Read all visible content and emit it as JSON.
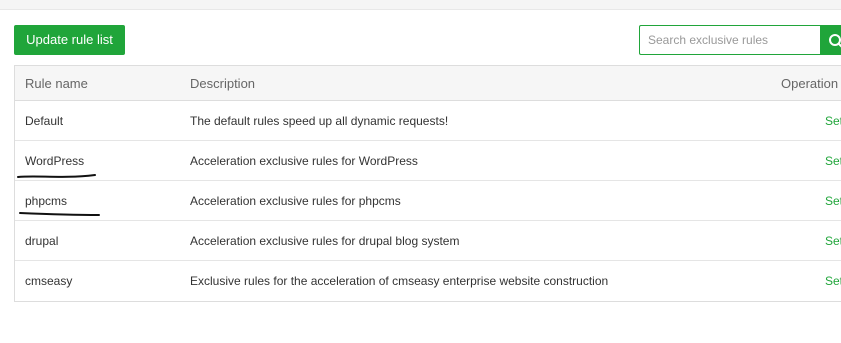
{
  "toolbar": {
    "update_label": "Update rule list",
    "search_placeholder": "Search exclusive rules"
  },
  "table": {
    "headers": {
      "name": "Rule name",
      "description": "Description",
      "operation": "Operation"
    },
    "rows": [
      {
        "name": "Default",
        "description": "The default rules speed up all dynamic requests!",
        "action": "Set"
      },
      {
        "name": "WordPress",
        "description": "Acceleration exclusive rules for WordPress",
        "action": "Set"
      },
      {
        "name": "phpcms",
        "description": "Acceleration exclusive rules for phpcms",
        "action": "Set"
      },
      {
        "name": "drupal",
        "description": "Acceleration exclusive rules for drupal blog system",
        "action": "Set"
      },
      {
        "name": "cmseasy",
        "description": "Exclusive rules for the acceleration of cmseasy enterprise website construction",
        "action": "Set"
      }
    ]
  },
  "colors": {
    "accent": "#20a53a",
    "header_bg": "#f6f6f6",
    "border": "#dddddd"
  },
  "icons": {
    "search": "search-icon"
  }
}
